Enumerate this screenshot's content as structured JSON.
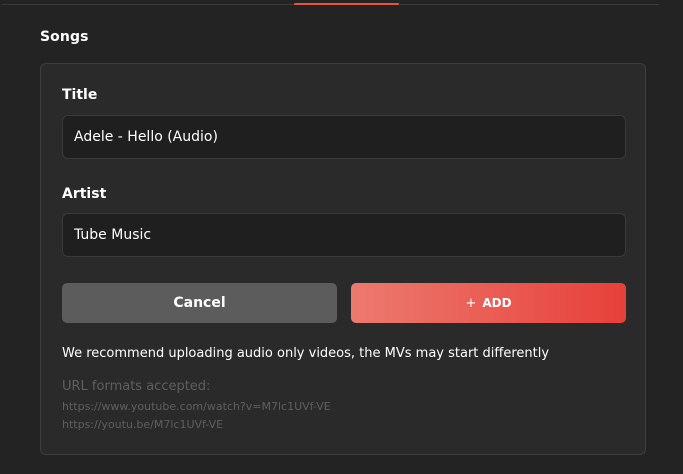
{
  "section": {
    "title": "Songs"
  },
  "form": {
    "title_label": "Title",
    "title_value": "Adele - Hello (Audio)",
    "artist_label": "Artist",
    "artist_value": "Tube Music"
  },
  "actions": {
    "cancel_label": "Cancel",
    "add_icon": "plus-icon",
    "add_icon_glyph": "+",
    "add_label": "ADD"
  },
  "notes": {
    "recommendation": "We recommend uploading audio only videos, the MVs may start differently",
    "formats_heading": "URL formats accepted:",
    "formats": [
      "https://www.youtube.com/watch?v=M7lc1UVf-VE",
      "https://youtu.be/M7lc1UVf-VE"
    ]
  },
  "colors": {
    "accent": "#e8533f",
    "add_gradient_start": "#ec7a6f",
    "add_gradient_end": "#e8403a",
    "cancel_bg": "#5c5c5c",
    "background": "#232323",
    "card_bg": "#2a2a2a"
  }
}
